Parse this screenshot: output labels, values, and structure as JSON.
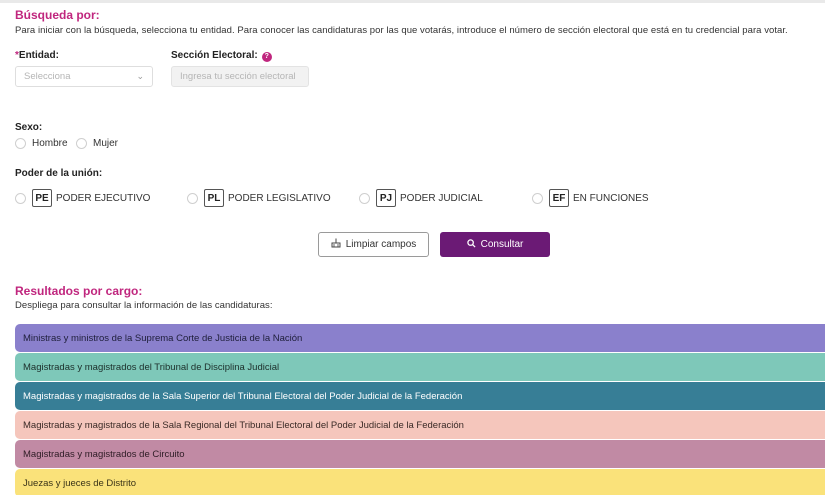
{
  "search": {
    "title": "Búsqueda por:",
    "description": "Para iniciar con la búsqueda, selecciona tu entidad. Para conocer las candidaturas por las que votarás, introduce el número de sección electoral que está en tu credencial para votar.",
    "entity_required_mark": "*",
    "entity_label": "Entidad:",
    "entity_placeholder": "Selecciona",
    "section_label": "Sección Electoral:",
    "section_placeholder": "Ingresa tu sección electoral",
    "help_glyph": "?"
  },
  "sex": {
    "label": "Sexo:",
    "options": [
      "Hombre",
      "Mujer"
    ]
  },
  "power": {
    "label": "Poder de la unión:",
    "options": [
      {
        "code": "PE",
        "label": "PODER EJECUTIVO"
      },
      {
        "code": "PL",
        "label": "PODER LEGISLATIVO"
      },
      {
        "code": "PJ",
        "label": "PODER JUDICIAL"
      },
      {
        "code": "EF",
        "label": "EN FUNCIONES"
      }
    ]
  },
  "buttons": {
    "clear": "Limpiar campos",
    "consult": "Consultar"
  },
  "results": {
    "title": "Resultados por cargo:",
    "description": "Despliega para consultar la información de las candidaturas:",
    "items": [
      {
        "label": "Ministras y ministros de la Suprema Corte de Justicia de la Nación",
        "color": "#8a80cc",
        "text_color": "#1e1e3a"
      },
      {
        "label": "Magistradas y magistrados del Tribunal de Disciplina Judicial",
        "color": "#7ec8b9",
        "text_color": "#1c2e2a"
      },
      {
        "label": "Magistradas y magistrados de la Sala Superior del Tribunal Electoral del Poder Judicial de la Federación",
        "color": "#377e96",
        "text_color": "#ffffff"
      },
      {
        "label": "Magistradas y magistrados de la Sala Regional del Tribunal Electoral del Poder Judicial de la Federación",
        "color": "#f5c6bc",
        "text_color": "#3a2a26"
      },
      {
        "label": "Magistradas y magistrados de Circuito",
        "color": "#c18aa4",
        "text_color": "#2e1c25"
      },
      {
        "label": "Juezas y jueces de Distrito",
        "color": "#fae27a",
        "text_color": "#3a3418"
      }
    ]
  }
}
